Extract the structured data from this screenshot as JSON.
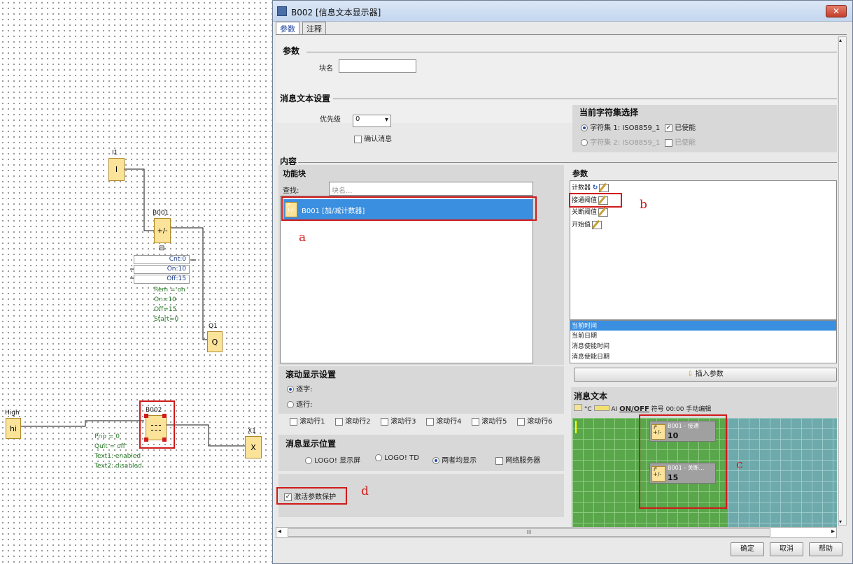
{
  "canvas": {
    "i1_label": "I1",
    "i1_text": "I",
    "b001_label": "B001",
    "b001_text": "+/-",
    "params": [
      {
        "name": "Cnt",
        "value": "0"
      },
      {
        "name": "On",
        "value": "10"
      },
      {
        "name": "Off",
        "value": "15"
      }
    ],
    "b001_info": [
      "Rem = on",
      "On=10",
      "Off=15",
      "Start=0"
    ],
    "q1_label": "Q1",
    "q1_text": "Q",
    "hi_label": "High",
    "hi_text": "hi",
    "b002_label": "B002",
    "b002_info": [
      "Prio = 0",
      "Quit = off",
      "Text1: enabled",
      "Text2: disabled"
    ],
    "x1_label": "X1",
    "x1_text": "X",
    "collapse_glyph": "⊟"
  },
  "dialog": {
    "title": "B002 [信息文本显示器]",
    "close_glyph": "✕",
    "tabs": [
      "参数",
      "注释"
    ],
    "sections": {
      "params": "参数",
      "block_name_label": "块名",
      "block_name_value": "",
      "msg_settings": "消息文本设置",
      "priority_label": "优先级",
      "priority_value": "0",
      "confirm_msg": "确认消息",
      "charset_title": "当前字符集选择",
      "charset1": "字符集 1: ISO8859_1",
      "charset1_enabled": "已使能",
      "charset2": "字符集 2: ISO8859_1",
      "charset2_enabled": "已使能",
      "content": "内容",
      "func_blocks": "功能块",
      "search_label": "查找:",
      "search_placeholder": "块名...",
      "selected_block": "B001 [加/减计数器]",
      "params_list_title": "参数",
      "param_items": [
        "计数器",
        "接通阈值",
        "关断阈值",
        "开始值"
      ],
      "time_items": [
        "当前时间",
        "当前日期",
        "消息使能时间",
        "消息使能日期"
      ],
      "insert_param": "插入参数",
      "scroll_title": "滚动显示设置",
      "scroll_char": "逐字:",
      "scroll_line": "逐行:",
      "scroll_rows": [
        "滚动行1",
        "滚动行2",
        "滚动行3",
        "滚动行4",
        "滚动行5",
        "滚动行6"
      ],
      "position_title": "消息显示位置",
      "positions": [
        "LOGO! 显示屏",
        "LOGO! TD",
        "两者均显示",
        "网络服务器"
      ],
      "protect": "激活参数保护",
      "msg_text_title": "消息文本",
      "toolbar": [
        "°C",
        "AI",
        "ON/OFF",
        "符号",
        "00:00",
        "手动编辑"
      ],
      "msg_blocks": [
        {
          "title": "B001 - 接通",
          "value": "10"
        },
        {
          "title": "B001 - 关断...",
          "value": "15"
        }
      ]
    },
    "annotations": [
      "a",
      "b",
      "c",
      "d"
    ],
    "buttons": {
      "ok": "确定",
      "cancel": "取消",
      "help": "帮助"
    },
    "h_scroll_label": "III"
  }
}
